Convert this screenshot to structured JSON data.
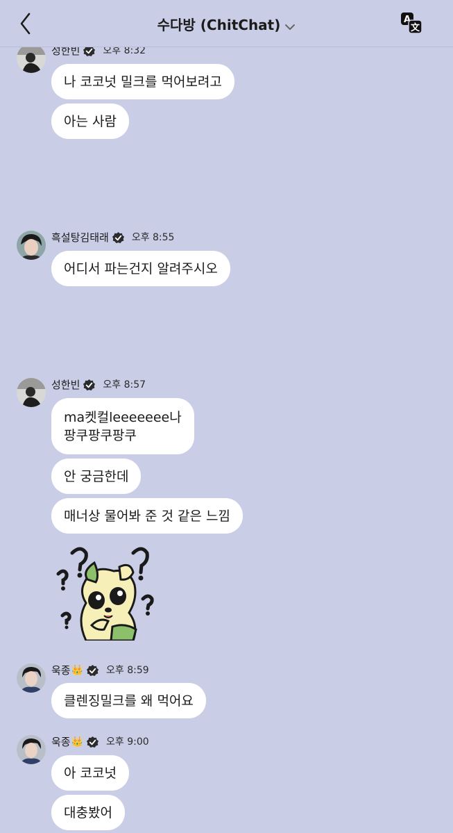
{
  "header": {
    "title": "수다방 (ChitChat)"
  },
  "messages": [
    {
      "name": "성한빈",
      "time": "오후 8:32",
      "bubbles": [
        "나 코코넛 밀크를 먹어보려고",
        "아는 사람"
      ]
    },
    {
      "name": "흑설탕김태래",
      "time": "오후 8:55",
      "bubbles": [
        "어디서 파는건지 알려주시오"
      ]
    },
    {
      "name": "성한빈",
      "time": "오후 8:57",
      "bubbles": [
        "ma켓컬leeeeeee나\n팡쿠팡쿠팡쿠",
        "안 궁금한데",
        "매너상 물어봐 준 것 같은 느낌"
      ]
    },
    {
      "name": "욱종",
      "time": "오후 8:59",
      "bubbles": [
        "클렌징밀크를 왜 먹어요"
      ]
    },
    {
      "name": "욱종",
      "time": "오후 9:00",
      "bubbles": [
        "아 코코넛",
        "대충봤어"
      ]
    }
  ],
  "icons": {
    "back": "chevron-left-icon",
    "dropdown": "chevron-down-icon",
    "translate": "translate-icon",
    "verified": "verified-check-icon",
    "crown": "crown-icon"
  },
  "crown_glyph": "👑",
  "colors": {
    "background": "#c9cde6",
    "bubble": "#ffffff"
  }
}
